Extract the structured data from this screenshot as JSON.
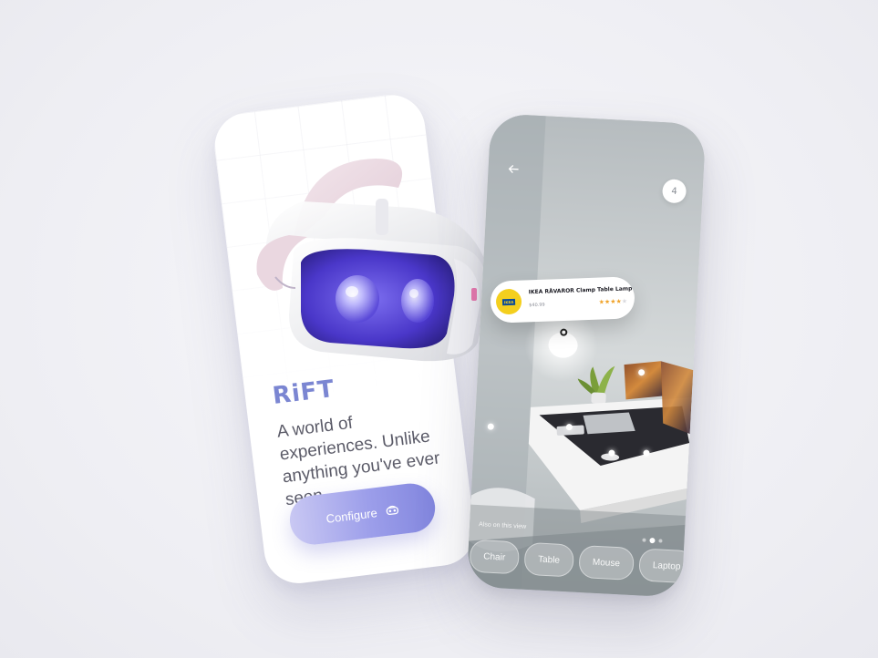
{
  "left_phone": {
    "brand": "RiFT",
    "tagline": "A world of experiences. Unlike anything you've ever seen.",
    "configure_button": "Configure"
  },
  "right_phone": {
    "back_icon": "arrow-left-icon",
    "item_count": "4",
    "also_label": "Also on this view",
    "chips": [
      "Chair",
      "Table",
      "Mouse",
      "Laptop"
    ],
    "pager": {
      "total": 3,
      "active": 2
    }
  },
  "product_card": {
    "logo_text": "IKEA",
    "title": "IKEA RÅVAROR Clamp Table Lamp",
    "price": "$40.99",
    "rating": 4,
    "rating_max": 5
  },
  "colors": {
    "accent": "#7b86d2",
    "button_gradient_end": "#8286de",
    "ikea_yellow": "#f4cf1e",
    "star": "#f0a32a"
  }
}
